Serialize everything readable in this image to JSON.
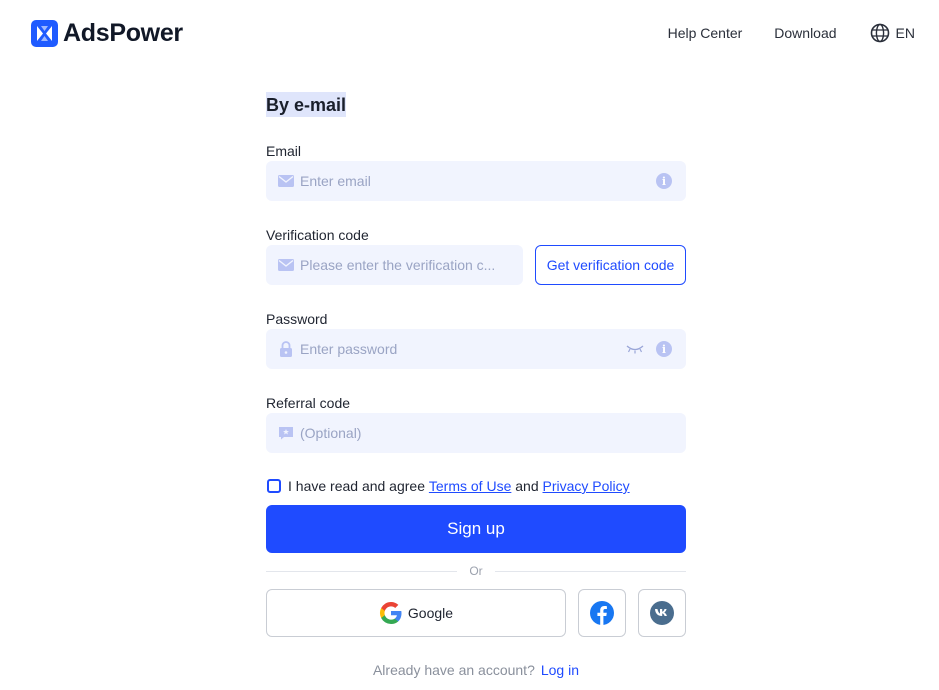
{
  "header": {
    "brand": "AdsPower",
    "nav": {
      "help_center": "Help Center",
      "download": "Download",
      "language": "EN"
    }
  },
  "form": {
    "title": "By e-mail",
    "email": {
      "label": "Email",
      "placeholder": "Enter email",
      "value": ""
    },
    "verification": {
      "label": "Verification code",
      "placeholder": "Please enter the verification c...",
      "value": "",
      "button": "Get verification code"
    },
    "password": {
      "label": "Password",
      "placeholder": "Enter password",
      "value": ""
    },
    "referral": {
      "label": "Referral code",
      "placeholder": "(Optional)",
      "value": ""
    },
    "agreement": {
      "prefix": "I have read and agree",
      "terms": "Terms of Use",
      "and": "and",
      "privacy": "Privacy Policy",
      "checked": false
    },
    "signup_button": "Sign up",
    "divider": "Or",
    "social": {
      "google": "Google",
      "facebook_icon": "facebook-icon",
      "vk_icon": "vk-icon"
    },
    "footer": {
      "text": "Already have an account?",
      "login": "Log in"
    }
  },
  "colors": {
    "primary": "#1f4bff",
    "field_bg": "#f1f4fe",
    "icon_muted": "#b9c3f3"
  }
}
